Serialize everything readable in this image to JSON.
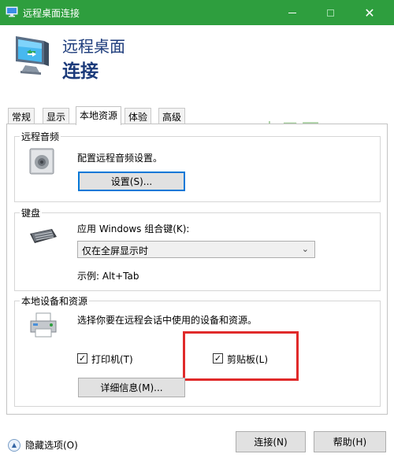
{
  "window": {
    "title": "远程桌面连接",
    "close_glyph": "✕",
    "colors": {
      "titlebar": "#2e9e3e",
      "header_text": "#1b3a7a",
      "highlight": "#e02a2a"
    }
  },
  "header": {
    "line1": "远程桌面",
    "line2": "连接"
  },
  "tabs": [
    {
      "label": "常规"
    },
    {
      "label": "显示"
    },
    {
      "label": "本地资源",
      "active": true
    },
    {
      "label": "体验"
    },
    {
      "label": "高级"
    }
  ],
  "watermark": "吉云网",
  "audio": {
    "group_label": "远程音频",
    "description": "配置远程音频设置。",
    "settings_button": "设置(S)..."
  },
  "keyboard": {
    "group_label": "键盘",
    "description": "应用 Windows 组合键(K):",
    "selected_option": "仅在全屏显示时",
    "example": "示例: Alt+Tab"
  },
  "local_devices": {
    "group_label": "本地设备和资源",
    "description": "选择你要在远程会话中使用的设备和资源。",
    "printer": {
      "label": "打印机(T)",
      "checked": true
    },
    "clipboard": {
      "label": "剪贴板(L)",
      "checked": true
    },
    "details_button": "详细信息(M)..."
  },
  "footer": {
    "hide_options": "隐藏选项(O)",
    "connect_button": "连接(N)",
    "help_button": "帮助(H)"
  },
  "check_glyph": "✓",
  "icons": {
    "app": "remote-desktop-icon",
    "header": "remote-monitor-icon",
    "audio": "speaker-icon",
    "keyboard": "keyboard-icon",
    "devices": "printer-icon",
    "hide": "chevron-up-circle-icon"
  }
}
